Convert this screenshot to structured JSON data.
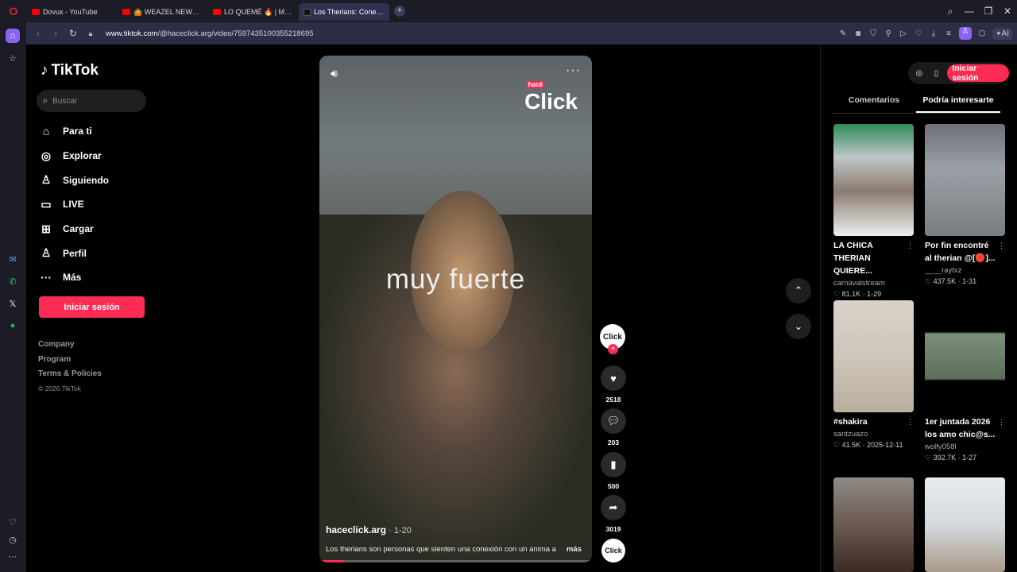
{
  "browser": {
    "logo": "O",
    "tabs": [
      {
        "label": "Dovux - YouTube",
        "icon": "youtube-icon"
      },
      {
        "label": "🤷 WEAZEL NEWS REP",
        "icon": "youtube-icon"
      },
      {
        "label": "LO QUEMÉ 🔥 | MEJO",
        "icon": "youtube-icon"
      },
      {
        "label": "Los Therians: Conexió",
        "icon": "tiktok-icon",
        "active": true
      }
    ],
    "new_tab": "+",
    "url_prefix": "www.tiktok.com",
    "url_path": "/@haceclick.arg/video/7597435100355218695",
    "ai_label": "AI"
  },
  "tiktok": {
    "logo": "TikTok",
    "search_placeholder": "Buscar",
    "menu": [
      {
        "label": "Para ti",
        "icon": "home-icon",
        "glyph": "⌂"
      },
      {
        "label": "Explorar",
        "icon": "compass-icon",
        "glyph": "◎"
      },
      {
        "label": "Siguiendo",
        "icon": "user-follow-icon",
        "glyph": "♙"
      },
      {
        "label": "LIVE",
        "icon": "live-tv-icon",
        "glyph": "▭"
      },
      {
        "label": "Cargar",
        "icon": "upload-icon",
        "glyph": "⊞"
      },
      {
        "label": "Perfil",
        "icon": "profile-icon",
        "glyph": "♙"
      },
      {
        "label": "Más",
        "icon": "more-icon",
        "glyph": "···"
      }
    ],
    "login": "Iniciar sesión",
    "footer": [
      "Company",
      "Program",
      "Terms & Policies"
    ],
    "copyright": "© 2026 TikTok"
  },
  "video": {
    "overlay_text": "muy fuerte",
    "brand_small": "hacé",
    "brand": "Click",
    "author": "haceclick.arg",
    "date": " · 1-20",
    "description": "Los therians son personas que sienten una conexión con un anima a",
    "more": "más",
    "progress": 0.09,
    "avatar_text": "Click",
    "follow": "+",
    "likes": "2518",
    "comments": "203",
    "saves": "500",
    "shares": "3019"
  },
  "right": {
    "login": "Iniciar sesión",
    "tabs": [
      "Comentarios",
      "Podría interesarte"
    ],
    "active_tab": 1,
    "cards": [
      {
        "title": "LA CHICA THERIAN QUIERE...",
        "author": "carnavalstream",
        "likes": "81.1K",
        "date": "1-29"
      },
      {
        "title": "Por fin encontré al therian @[🔴]...",
        "author": "____raytxz",
        "likes": "437.5K",
        "date": "1-31"
      },
      {
        "title": "#shakira",
        "author": "santzuazo",
        "likes": "41.5K",
        "date": "2025-12-11"
      },
      {
        "title": "1er juntada 2026 los amo chic@s...",
        "author": "wolfy058l",
        "likes": "392.7K",
        "date": "1-27"
      }
    ]
  }
}
